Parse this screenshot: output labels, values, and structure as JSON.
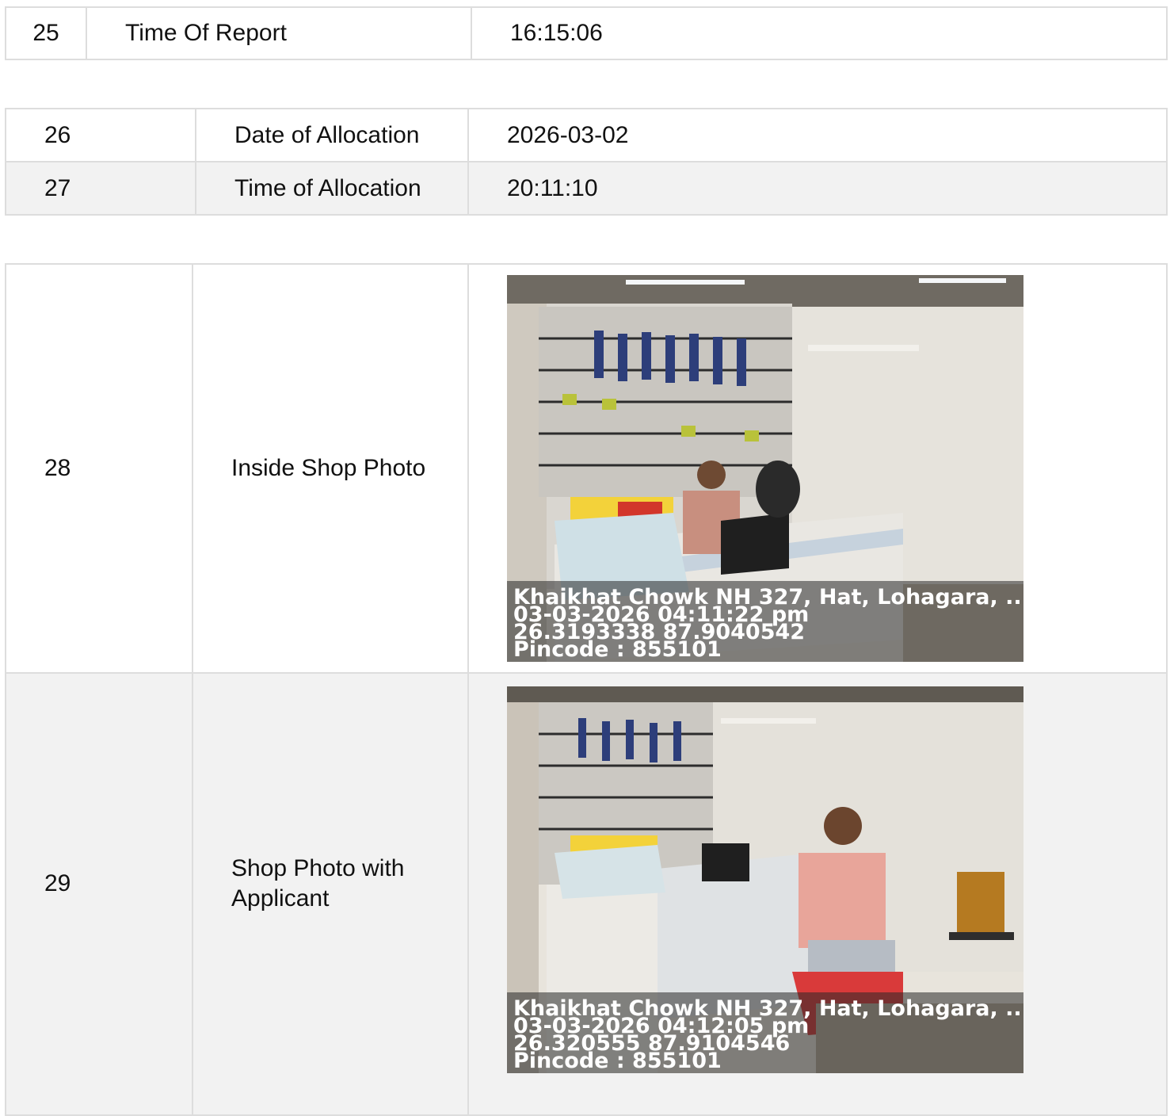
{
  "table1": {
    "rows": [
      {
        "no": "25",
        "label": "Time Of Report",
        "value": "16:15:06"
      }
    ]
  },
  "table2": {
    "rows": [
      {
        "no": "26",
        "label": "Date of Allocation",
        "value": "2026-03-02"
      },
      {
        "no": "27",
        "label": "Time of Allocation",
        "value": "20:11:10"
      }
    ]
  },
  "table3": {
    "rows": [
      {
        "no": "28",
        "label": "Inside Shop Photo",
        "photo": {
          "description": "shop interior with man seated behind laptop counter",
          "stamp": {
            "address": "Khaikhat Chowk NH 327, Hat, Lohagara, ...",
            "datetime": "03-03-2026 04:11:22 pm",
            "coords": "26.3193338 87.9040542",
            "pincode": "Pincode : 855101"
          }
        }
      },
      {
        "no": "29",
        "label": "Shop Photo with Applicant",
        "photo": {
          "description": "man seated on red chair in shop",
          "stamp": {
            "address": "Khaikhat Chowk NH 327, Hat, Lohagara, ...",
            "datetime": "03-03-2026 04:12:05 pm",
            "coords": "26.320555 87.9104546",
            "pincode": "Pincode : 855101"
          }
        }
      }
    ]
  }
}
